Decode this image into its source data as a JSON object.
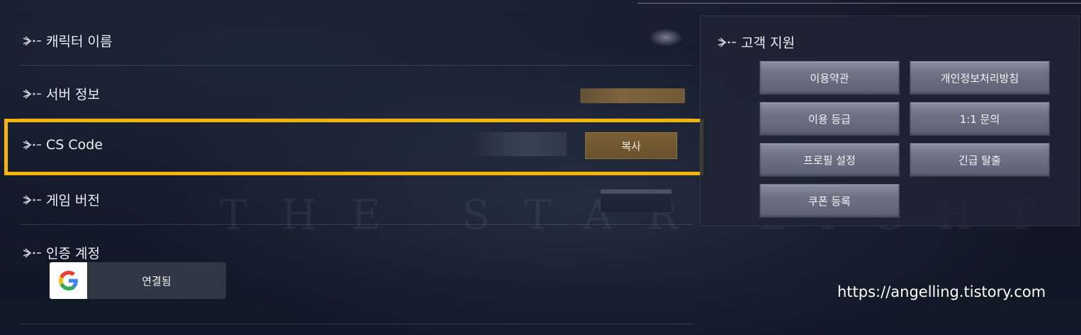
{
  "account": {
    "rows": [
      {
        "label": "캐릭터 이름"
      },
      {
        "label": "서버 정보"
      },
      {
        "label": "CS Code"
      },
      {
        "label": "게임 버전"
      },
      {
        "label": "인증 계정"
      }
    ],
    "copy_button": "복사",
    "google_status": "연결됨"
  },
  "support": {
    "title": "고객 지원",
    "buttons": [
      "이용약관",
      "개인정보처리방침",
      "이용 등급",
      "1:1 문의",
      "프로필 설정",
      "긴급 탈출",
      "쿠폰 등록"
    ]
  },
  "watermark": "https://angelling.tistory.com",
  "colors": {
    "highlight": "#f7b500",
    "copy_button": "#6a522c",
    "panel": "#1e2534"
  }
}
